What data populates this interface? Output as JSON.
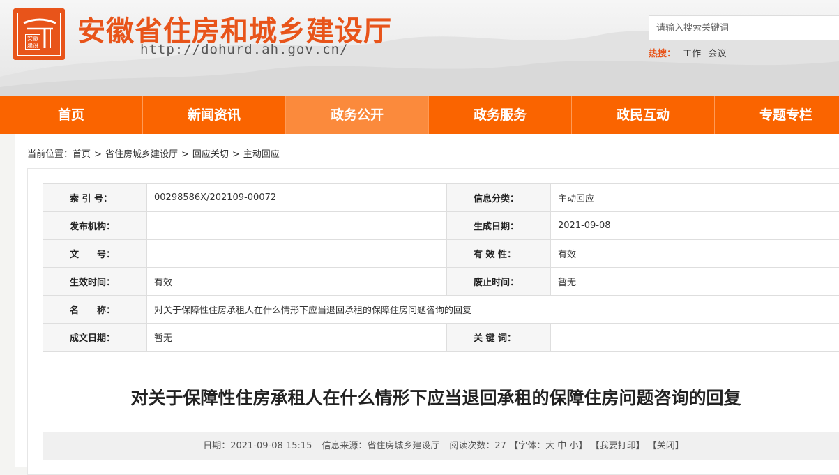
{
  "header": {
    "site_title": "安徽省住房和城乡建设厅",
    "site_url": "http://dohurd.ah.gov.cn/",
    "logo_seal_text": "安徽建设",
    "search_placeholder": "请输入搜索关键词",
    "hot_label": "热搜：",
    "hot_items": [
      "工作",
      "会议"
    ]
  },
  "nav": [
    "首页",
    "新闻资讯",
    "政务公开",
    "政务服务",
    "政民互动",
    "专题专栏"
  ],
  "breadcrumb": {
    "prefix": "当前位置：",
    "items": [
      "首页",
      "省住房城乡建设厅",
      "回应关切",
      "主动回应"
    ],
    "separator": ">"
  },
  "meta": [
    [
      "索 引 号：",
      "00298586X/202109-00072",
      "信息分类：",
      "主动回应"
    ],
    [
      "发布机构：",
      "",
      "生成日期：",
      "2021-09-08"
    ],
    [
      "文　　号：",
      "",
      "有 效 性：",
      "有效"
    ],
    [
      "生效时间：",
      "有效",
      "废止时间：",
      "暂无"
    ],
    [
      "名　　称：",
      "对关于保障性住房承租人在什么情形下应当退回承租的保障住房问题咨询的回复"
    ],
    [
      "成文日期：",
      "暂无",
      "关 键 词：",
      ""
    ]
  ],
  "article": {
    "title": "对关于保障性住房承租人在什么情形下应当退回承租的保障住房问题咨询的回复",
    "date_text": "日期：2021-09-08 15:15",
    "source_text": "信息来源：省住房城乡建设厅",
    "views_text": "阅读次数：27",
    "font_label": "【字体：",
    "font_large": "大",
    "font_medium": "中",
    "font_small": "小",
    "font_close": "】",
    "print_label": "【我要打印】",
    "close_label": "【关闭】"
  },
  "colors": {
    "brand": "#e8541a",
    "nav": "#fa6400",
    "nav_active": "#fb8a3c"
  }
}
